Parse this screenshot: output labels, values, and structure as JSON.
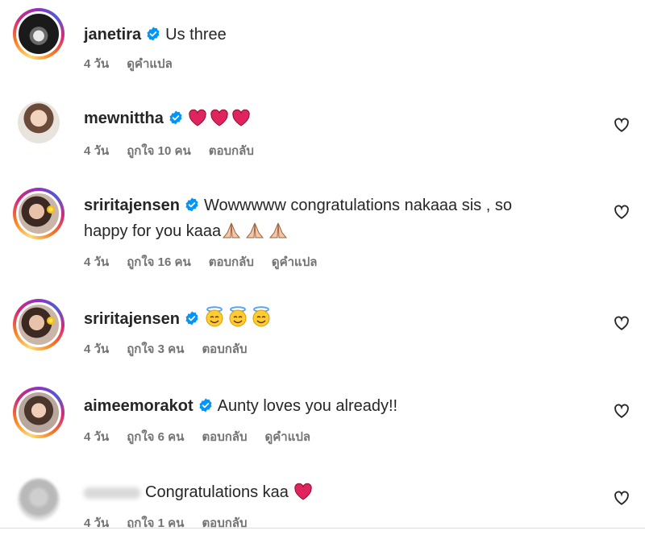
{
  "comments": [
    {
      "username": "janetira",
      "verified": true,
      "text": "Us three",
      "time": "4 วัน",
      "likes": "",
      "reply": "",
      "translate": "ดูคำแปล"
    },
    {
      "username": "mewnittha",
      "verified": true,
      "text": "",
      "emojis": [
        "heart",
        "heart",
        "heart"
      ],
      "time": "4 วัน",
      "likes": "ถูกใจ 10 คน",
      "reply": "ตอบกลับ",
      "translate": ""
    },
    {
      "username": "sriritajensen",
      "verified": true,
      "text": "Wowwwww congratulations nakaaa sis , so",
      "text_line2": "happy for you kaaa",
      "emojis": [
        "folded-hands",
        "folded-hands",
        "folded-hands"
      ],
      "time": "4 วัน",
      "likes": "ถูกใจ 16 คน",
      "reply": "ตอบกลับ",
      "translate": "ดูคำแปล"
    },
    {
      "username": "sriritajensen",
      "verified": true,
      "text": "",
      "emojis": [
        "smiling-face-with-halo",
        "smiling-face-with-halo",
        "smiling-face-with-halo"
      ],
      "time": "4 วัน",
      "likes": "ถูกใจ 3 คน",
      "reply": "ตอบกลับ",
      "translate": ""
    },
    {
      "username": "aimeemorakot",
      "verified": true,
      "text": "Aunty loves you already!!",
      "time": "4 วัน",
      "likes": "ถูกใจ 6 คน",
      "reply": "ตอบกลับ",
      "translate": "ดูคำแปล"
    },
    {
      "username": "",
      "verified": false,
      "text": "Congratulations kaa",
      "emojis": [
        "heart"
      ],
      "time": "4 วัน",
      "likes": "ถูกใจ 1 คน",
      "reply": "ตอบกลับ",
      "translate": ""
    }
  ],
  "colors": {
    "verified": "#0095f6",
    "heart": "#e0245e",
    "meta": "#737373",
    "text": "#262626"
  },
  "icons": {
    "like": "heart-outline-icon",
    "verified": "verified-badge-icon"
  }
}
